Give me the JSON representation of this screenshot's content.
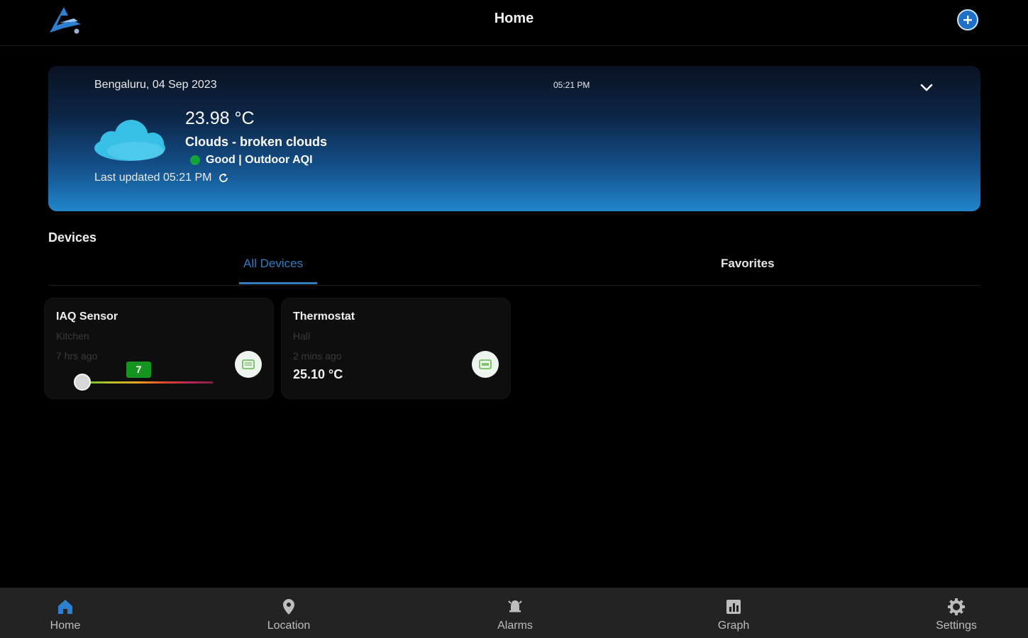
{
  "header": {
    "title": "Home",
    "logo_icon": "app-logo",
    "add_icon": "add-circle-icon"
  },
  "weather": {
    "location_date": "Bengaluru, 04 Sep 2023",
    "time": "05:21 PM",
    "temperature": "23.98 °C",
    "condition": "Clouds - broken clouds",
    "aqi": "Good | Outdoor AQI",
    "aqi_color": "#14a33a",
    "last_updated": "Last updated 05:21 PM"
  },
  "devices": {
    "title": "Devices",
    "tabs": [
      {
        "label": "All Devices",
        "active": true
      },
      {
        "label": "Favorites",
        "active": false
      }
    ],
    "cards": [
      {
        "name": "IAQ Sensor",
        "location": "Kitchen",
        "updated": "7 hrs ago",
        "aqi_value": "7",
        "aqi_level": 0.04,
        "icon": "air-quality-sensor-icon"
      },
      {
        "name": "Thermostat",
        "location": "Hall",
        "updated": "2 mins ago",
        "temperature": "25.10 °C",
        "icon": "thermostat-icon"
      }
    ]
  },
  "nav": {
    "items": [
      {
        "label": "Home",
        "icon": "home-icon",
        "active": true
      },
      {
        "label": "Location",
        "icon": "location-pin-icon",
        "active": false
      },
      {
        "label": "Alarms",
        "icon": "alarm-bell-icon",
        "active": false
      },
      {
        "label": "Graph",
        "icon": "graph-icon",
        "active": false
      },
      {
        "label": "Settings",
        "icon": "gear-icon",
        "active": false
      }
    ]
  },
  "colors": {
    "accent": "#2e7dc1",
    "background": "#000000",
    "nav_background": "#232323",
    "active_nav_icon": "#2f7fd1"
  }
}
